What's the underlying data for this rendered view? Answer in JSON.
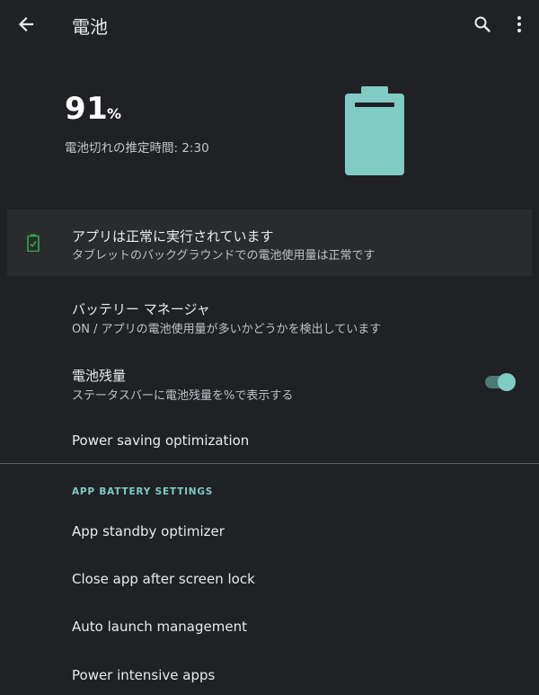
{
  "app_bar": {
    "title": "電池",
    "back_icon": "arrow-back-icon",
    "search_icon": "search-icon",
    "more_icon": "more-vert-icon"
  },
  "battery": {
    "level": "91",
    "percent_sign": "%",
    "estimate": "電池切れの推定時間: 2:30",
    "fill_fraction": 0.91,
    "color": "#80cbc4"
  },
  "status": {
    "title": "アプリは正常に実行されています",
    "summary": "タブレットのバックグラウンドでの電池使用量は正常です",
    "icon": "battery-ok-icon",
    "icon_color": "#34a853"
  },
  "preferences": [
    {
      "title": "バッテリー マネージャ",
      "summary": "ON / アプリの電池使用量が多いかどうかを検出しています"
    },
    {
      "title": "電池残量",
      "summary": "ステータスバーに電池残量を%で表示する",
      "toggle_on": true
    },
    {
      "title": "Power saving optimization"
    }
  ],
  "app_battery_settings": {
    "header": "APP BATTERY SETTINGS",
    "items": [
      {
        "title": "App standby optimizer"
      },
      {
        "title": "Close app after screen lock"
      },
      {
        "title": "Auto launch management"
      },
      {
        "title": "Power intensive apps"
      }
    ]
  },
  "colors": {
    "background": "#202124",
    "accent": "#80cbc4",
    "card": "#2a2b2d"
  }
}
